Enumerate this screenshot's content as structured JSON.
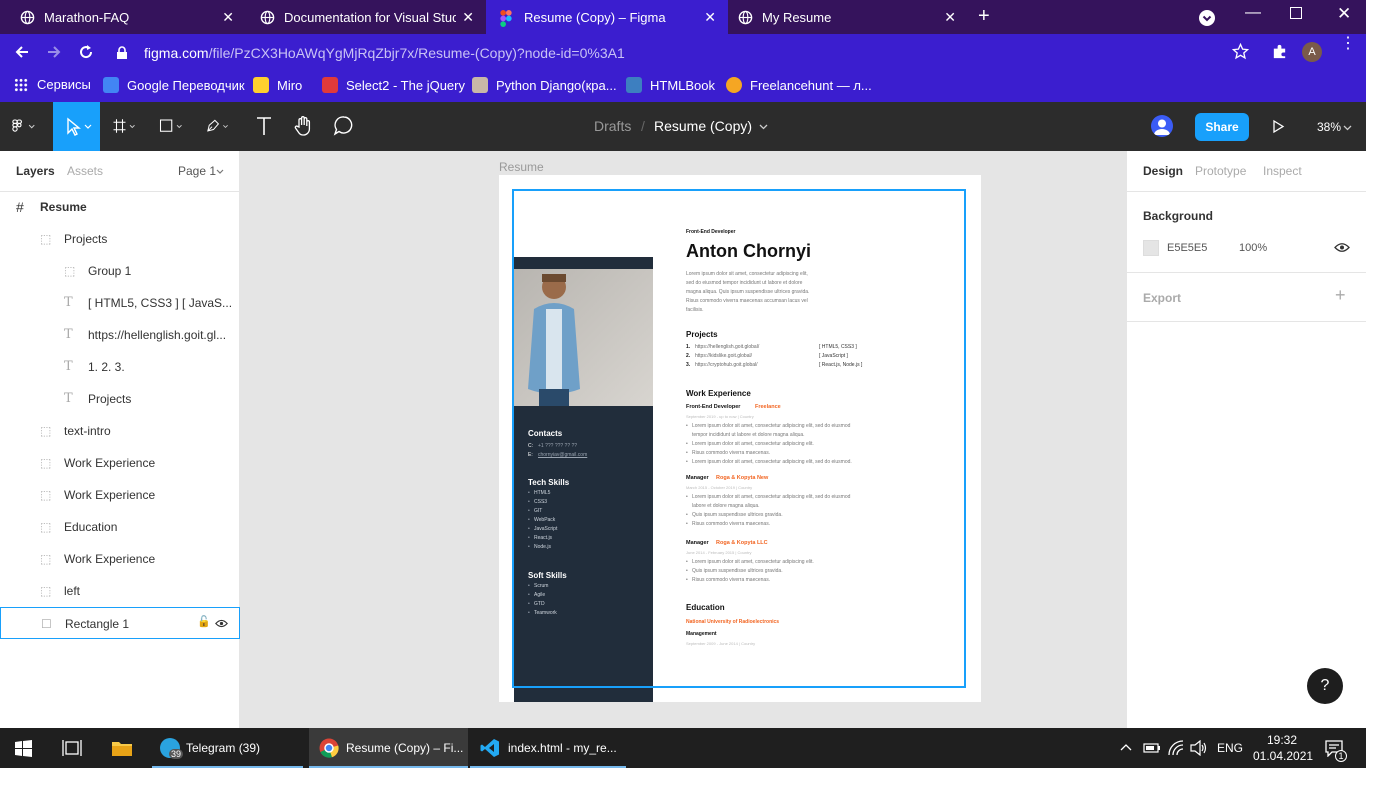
{
  "browser": {
    "tabs": [
      {
        "title": "Marathon-FAQ",
        "icon": "globe-icon"
      },
      {
        "title": "Documentation for Visual Studio",
        "icon": "globe-icon"
      },
      {
        "title": "Resume (Copy) – Figma",
        "icon": "figma-icon",
        "active": true
      },
      {
        "title": "My Resume",
        "icon": "globe-icon"
      }
    ],
    "url_host": "figma.com",
    "url_path": "/file/PzCX3HoAWqYgMjRqZbjr7x/Resume-(Copy)?node-id=0%3A1",
    "profile_initial": "A",
    "bookmarks": [
      "Сервисы",
      "Google Переводчик",
      "Miro",
      "Select2 - The jQuery",
      "Python Django(кра...",
      "HTMLBook",
      "Freelancehunt — л..."
    ]
  },
  "figma": {
    "breadcrumb_root": "Drafts",
    "breadcrumb_sep": "/",
    "file_name": "Resume (Copy)",
    "share_label": "Share",
    "zoom": "38%",
    "left_tabs": [
      "Layers",
      "Assets"
    ],
    "page_select": "Page 1",
    "layers": [
      {
        "name": "Resume",
        "type": "frame",
        "indent": 0
      },
      {
        "name": "Projects",
        "type": "group",
        "indent": 1
      },
      {
        "name": "Group 1",
        "type": "group",
        "indent": 2
      },
      {
        "name": "[ HTML5, CSS3 ] [ JavaS...",
        "type": "text",
        "indent": 2
      },
      {
        "name": "https://hellenglish.goit.gl...",
        "type": "text",
        "indent": 2
      },
      {
        "name": "1. 2. 3.",
        "type": "text",
        "indent": 2
      },
      {
        "name": "Projects",
        "type": "text",
        "indent": 2
      },
      {
        "name": "text-intro",
        "type": "group",
        "indent": 1
      },
      {
        "name": "Work Experience",
        "type": "group",
        "indent": 1
      },
      {
        "name": "Work Experience",
        "type": "group",
        "indent": 1
      },
      {
        "name": "Education",
        "type": "group",
        "indent": 1
      },
      {
        "name": "Work Experience",
        "type": "group",
        "indent": 1
      },
      {
        "name": "left",
        "type": "group",
        "indent": 1
      },
      {
        "name": "Rectangle 1",
        "type": "rect",
        "indent": 1,
        "selected": true
      }
    ],
    "frame_label": "Resume",
    "right_tabs": [
      "Design",
      "Prototype",
      "Inspect"
    ],
    "background_label": "Background",
    "bg_hex": "E5E5E5",
    "bg_opacity": "100%",
    "export_label": "Export",
    "help": "?"
  },
  "resume": {
    "role": "Front-End Developer",
    "name": "Anton Chornyi",
    "intro": [
      "Lorem ipsum dolor sit amet, consectetur adipiscing elit,",
      "sed do eiusmod tempor incididunt ut labore et dolore",
      "magna aliqua. Quis ipsum suspendisse ultrices gravida.",
      "Risus commodo viverra maecenas accumsan lacus vel",
      "facilisis."
    ],
    "projects_title": "Projects",
    "projects": [
      {
        "n": "1.",
        "url": "https://hellenglish.goit.global/",
        "tech": "[ HTML5, CSS3 ]"
      },
      {
        "n": "2.",
        "url": "https://kidslike.goit.global/",
        "tech": "[ JavaScript ]"
      },
      {
        "n": "3.",
        "url": "https://cryptohub.goit.global/",
        "tech": "[ React.js, Node.js ]"
      }
    ],
    "work_title": "Work Experience",
    "jobs": [
      {
        "role": "Front-End Developer",
        "company": "Freelance",
        "dates": "September 2019 - up to now  |  Country",
        "items": [
          "Lorem ipsum dolor sit amet, consectetur adipiscing elit, sed do eiusmod",
          "tempor incididunt ut labore et dolore magna aliqua.",
          "Lorem ipsum dolor sit amet, consectetur adipiscing elit.",
          "Risus commodo viverra maecenas.",
          "Lorem ipsum dolor sit amet, consectetur adipiscing elit, sed do eiusmod."
        ]
      },
      {
        "role": "Manager",
        "company": "Roga & Kopyta New",
        "dates": "March 2015 - October 2019  |  Country",
        "items": [
          "Lorem ipsum dolor sit amet, consectetur adipiscing elit, sed do eiusmod",
          "labore et dolore magna aliqua.",
          "Quis ipsum suspendisse ultrices gravida.",
          "Risus commodo viverra maecenas."
        ]
      },
      {
        "role": "Manager",
        "company": "Roga & Kopyta LLC",
        "dates": "June 2014 - February 2015  |  Country",
        "items": [
          "Lorem ipsum dolor sit amet, consectetur adipiscing elit.",
          "Quis ipsum suspendisse ultrices gravida.",
          "Risus commodo viverra maecenas."
        ]
      }
    ],
    "edu_title": "Education",
    "edu_school": "National University of Radioelectronics",
    "edu_major": "Management",
    "edu_dates": "September 2009 - June 2014  |  Country",
    "contacts_title": "Contacts",
    "phone_label": "С:",
    "phone": "+1 ??? ??? ?? ??",
    "email_label": "E:",
    "email": "chornyiav@gmail.com",
    "tech_title": "Tech Skills",
    "tech": [
      "HTML5",
      "CSS3",
      "GIT",
      "WebPack",
      "JavaScript",
      "React.js",
      "Node.js"
    ],
    "soft_title": "Soft Skills",
    "soft": [
      "Scrum",
      "Agile",
      "GTD",
      "Teamwork"
    ]
  },
  "taskbar": {
    "apps": [
      {
        "label": "Telegram (39)",
        "badge": "39"
      },
      {
        "label": "Resume (Copy) – Fi..."
      },
      {
        "label": "index.html - my_re..."
      }
    ],
    "lang": "ENG",
    "time": "19:32",
    "date": "01.04.2021",
    "notif": "1"
  },
  "colors": {
    "accent": "#18a0fb",
    "orange": "#f26522",
    "sidebar": "#212d3b",
    "tab_active": "#3b1ecf",
    "tabbar": "#35135c"
  }
}
